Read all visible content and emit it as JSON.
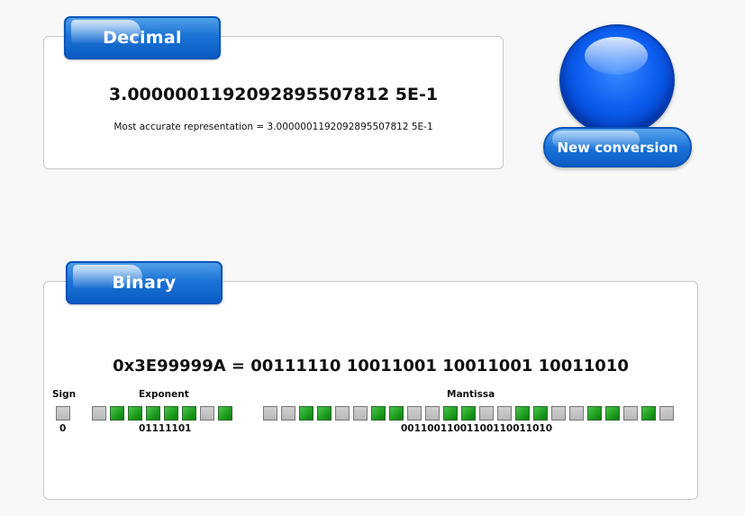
{
  "decimal": {
    "tab_label": "Decimal",
    "value": "3.0000001192092895507812 5E-1",
    "accurate_text": "Most accurate representation = 3.0000001192092895507812 5E-1"
  },
  "new_conversion": {
    "label": "New conversion"
  },
  "binary": {
    "tab_label": "Binary",
    "hex_line": "0x3E99999A = 00111110 10011001 10011001 10011010",
    "sign": {
      "label": "Sign",
      "bits": "0",
      "value": "0"
    },
    "exponent": {
      "label": "Exponent",
      "bits": "01111101",
      "value": "01111101"
    },
    "mantissa": {
      "label": "Mantissa",
      "bits": "00110011001100110011010",
      "value": "00110011001100110011010"
    }
  },
  "colors": {
    "bit_on": "#1fa01f",
    "bit_off": "#c4c4c4",
    "accent": "#1c73d6"
  }
}
